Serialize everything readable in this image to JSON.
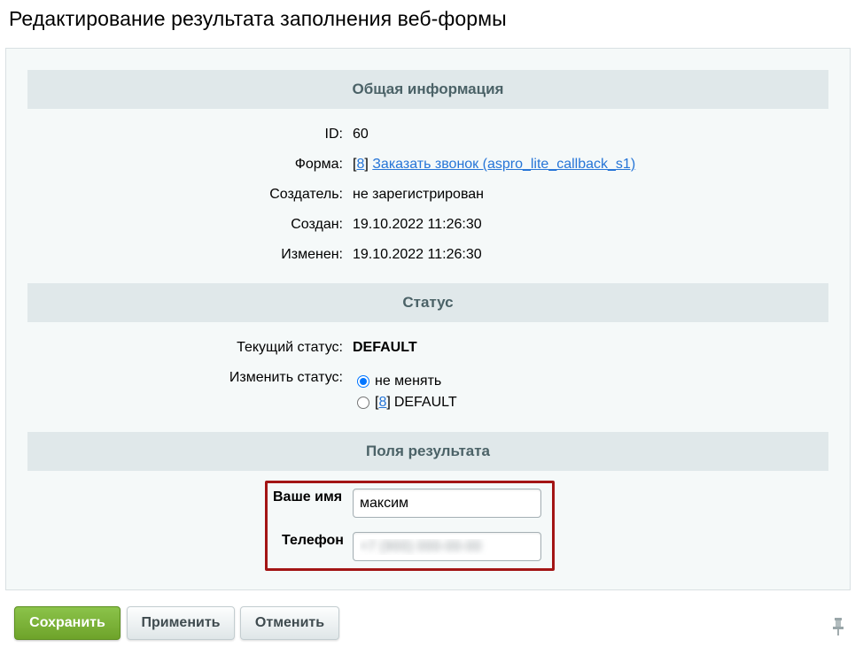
{
  "page": {
    "title": "Редактирование результата заполнения веб-формы"
  },
  "sections": {
    "general": "Общая информация",
    "status": "Статус",
    "fields": "Поля результата"
  },
  "general_info": {
    "id_label": "ID:",
    "id_value": "60",
    "form_label": "Форма:",
    "form_bracket_open": "[",
    "form_id": "8",
    "form_bracket_close": "]",
    "form_link": "Заказать звонок (aspro_lite_callback_s1)",
    "creator_label": "Создатель:",
    "creator_value": "не зарегистрирован",
    "created_label": "Создан:",
    "created_value": "19.10.2022 11:26:30",
    "modified_label": "Изменен:",
    "modified_value": "19.10.2022 11:26:30"
  },
  "status": {
    "current_label": "Текущий статус:",
    "current_value": "DEFAULT",
    "change_label": "Изменить статус:",
    "options": [
      {
        "label": "не менять",
        "checked": true
      },
      {
        "bracket_open": "[",
        "id": "8",
        "bracket_close": "]",
        "label": "DEFAULT",
        "checked": false
      }
    ]
  },
  "result_fields": {
    "name_label": "Ваше имя",
    "name_value": "максим",
    "phone_label": "Телефон",
    "phone_value": "+7 (900) 000-00-00"
  },
  "buttons": {
    "save": "Сохранить",
    "apply": "Применить",
    "cancel": "Отменить"
  },
  "colors": {
    "accent_green": "#7cb637",
    "link_blue": "#2675d7",
    "highlight_red": "#a31515",
    "section_bg": "#e0e8ea"
  }
}
